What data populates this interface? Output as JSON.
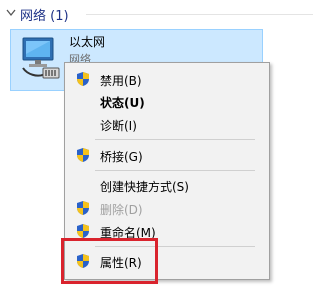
{
  "group": {
    "title": "网络 (1)"
  },
  "item": {
    "name": "以太网",
    "subtitle": "网络"
  },
  "menu": {
    "items": [
      {
        "label": "禁用(B)"
      },
      {
        "label": "状态(U)"
      },
      {
        "label": "诊断(I)"
      },
      {
        "label": "桥接(G)"
      },
      {
        "label": "创建快捷方式(S)"
      },
      {
        "label": "删除(D)"
      },
      {
        "label": "重命名(M)"
      },
      {
        "label": "属性(R)"
      }
    ]
  },
  "colors": {
    "group_title": "#1e3287",
    "selection_bg": "#cce8ff",
    "menu_bg": "#f2f2f2",
    "highlight_box": "#d9232d"
  }
}
